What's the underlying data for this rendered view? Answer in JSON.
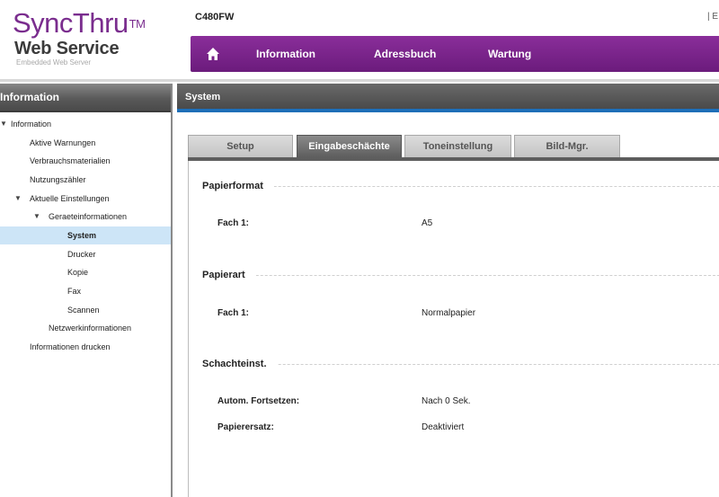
{
  "brand": {
    "logo_main": "SyncThru",
    "logo_tm": "TM",
    "logo_sub": "Web Service",
    "logo_tagline": "Embedded Web Server"
  },
  "device": {
    "model": "C480FW"
  },
  "top_right_text": "| E",
  "nav": {
    "home_icon": "home-icon",
    "items": [
      "Information",
      "Adressbuch",
      "Wartung"
    ]
  },
  "sidebar": {
    "title": "Information",
    "tree": [
      {
        "label": "Information",
        "level": 0,
        "expanded": true
      },
      {
        "label": "Aktive Warnungen",
        "level": 1
      },
      {
        "label": "Verbrauchsmaterialien",
        "level": 1
      },
      {
        "label": "Nutzungszähler",
        "level": 1
      },
      {
        "label": "Aktuelle Einstellungen",
        "level": 1,
        "expanded": true
      },
      {
        "label": "Geraeteinformationen",
        "level": 2,
        "expanded": true
      },
      {
        "label": "System",
        "level": 3,
        "selected": true
      },
      {
        "label": "Drucker",
        "level": 3
      },
      {
        "label": "Kopie",
        "level": 3
      },
      {
        "label": "Fax",
        "level": 3
      },
      {
        "label": "Scannen",
        "level": 3
      },
      {
        "label": "Netzwerkinformationen",
        "level": 2
      },
      {
        "label": "Informationen drucken",
        "level": 1
      }
    ]
  },
  "main": {
    "title": "System",
    "tabs": [
      {
        "label": "Setup",
        "active": false
      },
      {
        "label": "Eingabeschächte",
        "active": true
      },
      {
        "label": "Toneinstellung",
        "active": false
      },
      {
        "label": "Bild-Mgr.",
        "active": false
      }
    ],
    "sections": [
      {
        "title": "Papierformat",
        "fields": [
          {
            "label": "Fach 1:",
            "value": "A5"
          }
        ]
      },
      {
        "title": "Papierart",
        "fields": [
          {
            "label": "Fach 1:",
            "value": "Normalpapier"
          }
        ]
      },
      {
        "title": "Schachteinst.",
        "fields": [
          {
            "label": "Autom. Fortsetzen:",
            "value": "Nach 0 Sek."
          },
          {
            "label": "Papierersatz:",
            "value": "Deaktiviert"
          }
        ]
      }
    ]
  },
  "colors": {
    "brand_purple": "#7a2d8e",
    "nav_purple": "#7a2489",
    "accent_blue": "#1e6fb8",
    "selected_row": "#cde5f7"
  }
}
